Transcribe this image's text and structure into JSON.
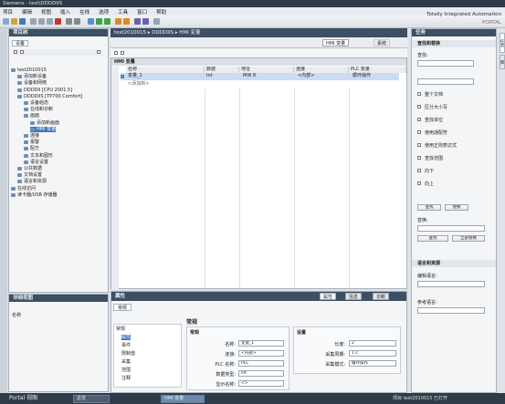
{
  "app": {
    "title": "Siemens - test\\DDDDIIS",
    "menu": [
      "项目",
      "编辑",
      "视图",
      "插入",
      "在线",
      "选项",
      "工具",
      "窗口",
      "帮助"
    ],
    "brand": "Totally Integrated Automation",
    "brand_sub": "PORTAL"
  },
  "left": {
    "header": "项目树",
    "tab": "设备",
    "tree": [
      {
        "label": "test2010015",
        "indent": 0,
        "sel": false
      },
      {
        "label": "添加新设备",
        "indent": 1,
        "sel": false
      },
      {
        "label": "设备和网络",
        "indent": 1,
        "sel": false
      },
      {
        "label": "DDDDII [CPU 2001.5]",
        "indent": 1,
        "sel": false
      },
      {
        "label": "DDDDIIS [TP700 Comfort]",
        "indent": 1,
        "sel": false
      },
      {
        "label": "设备组态",
        "indent": 2,
        "sel": false
      },
      {
        "label": "在线和诊断",
        "indent": 2,
        "sel": false
      },
      {
        "label": "画面",
        "indent": 2,
        "sel": false
      },
      {
        "label": "添加新画面",
        "indent": 3,
        "sel": false
      },
      {
        "label": "HMI 变量",
        "indent": 3,
        "sel": true
      },
      {
        "label": "连接",
        "indent": 2,
        "sel": false
      },
      {
        "label": "报警",
        "indent": 2,
        "sel": false
      },
      {
        "label": "配方",
        "indent": 2,
        "sel": false
      },
      {
        "label": "文本和图形",
        "indent": 2,
        "sel": false
      },
      {
        "label": "语言设置",
        "indent": 2,
        "sel": false
      },
      {
        "label": "公共数据",
        "indent": 1,
        "sel": false
      },
      {
        "label": "文档设置",
        "indent": 1,
        "sel": false
      },
      {
        "label": "语言和资源",
        "indent": 1,
        "sel": false
      },
      {
        "label": "在线访问",
        "indent": 0,
        "sel": false
      },
      {
        "label": "读卡器/USB 存储器",
        "indent": 0,
        "sel": false
      }
    ],
    "detail_header": "详细视图",
    "detail_col": "名称"
  },
  "center": {
    "breadcrumb": "test2010015 ▸ DDDDIIS ▸ HMI 变量",
    "tab1": "HMI 变量",
    "tab2": "系统",
    "subheader": "HMI 变量",
    "cols": [
      "名称",
      "数据",
      "地址",
      "连接",
      "PLC 变量",
      "访问",
      "采集模式"
    ],
    "rows": [
      [
        "变量_1",
        "Int",
        "MW 8",
        "<内部>",
        "",
        "",
        "循环操作"
      ],
      [
        "<添加新>",
        "",
        "",
        "",
        "",
        "",
        ""
      ]
    ]
  },
  "props": {
    "header": "属性",
    "tabs": [
      "属性",
      "信息",
      "诊断"
    ],
    "subtab": "常规",
    "nav": [
      "常规",
      "属性",
      "事件",
      "限制值",
      "采集",
      "范围",
      "注释"
    ],
    "title": "常规",
    "group1": "常规",
    "group2": "设置",
    "f1": {
      "label": "名称:",
      "value": "变量_1"
    },
    "f2": {
      "label": "连接:",
      "value": "<内部>"
    },
    "f3": {
      "label": "PLC 名称:",
      "value": "PLC"
    },
    "f4": {
      "label": "数据类型:",
      "value": "Int"
    },
    "f5": {
      "label": "显示名称:",
      "value": "<>"
    },
    "g1": {
      "label": "长度:",
      "value": "2"
    },
    "g2": {
      "label": "采集周期:",
      "value": "1 s"
    },
    "g3": {
      "label": "采集模式:",
      "value": "循环操作"
    }
  },
  "right": {
    "header": "任务",
    "section1": "查找和替换",
    "find": "查找:",
    "replace": "替换:",
    "opts": [
      "整个文档",
      "区分大小写",
      "查找单位",
      "使用通配符",
      "使用正则表达式",
      "查找范围",
      "向下",
      "向上"
    ],
    "btn_find": "查找",
    "btn_next": "替换",
    "btn_all": "全部替换",
    "section2": "语言和资源",
    "lang_label": "编辑语言:",
    "ref_label": "参考语言:",
    "side_tabs": [
      "任务",
      "库"
    ]
  },
  "task": {
    "portal": "Portal 视图",
    "items": [
      "总览",
      "HMI 变量"
    ],
    "status": "项目 test2010015 已打开"
  }
}
